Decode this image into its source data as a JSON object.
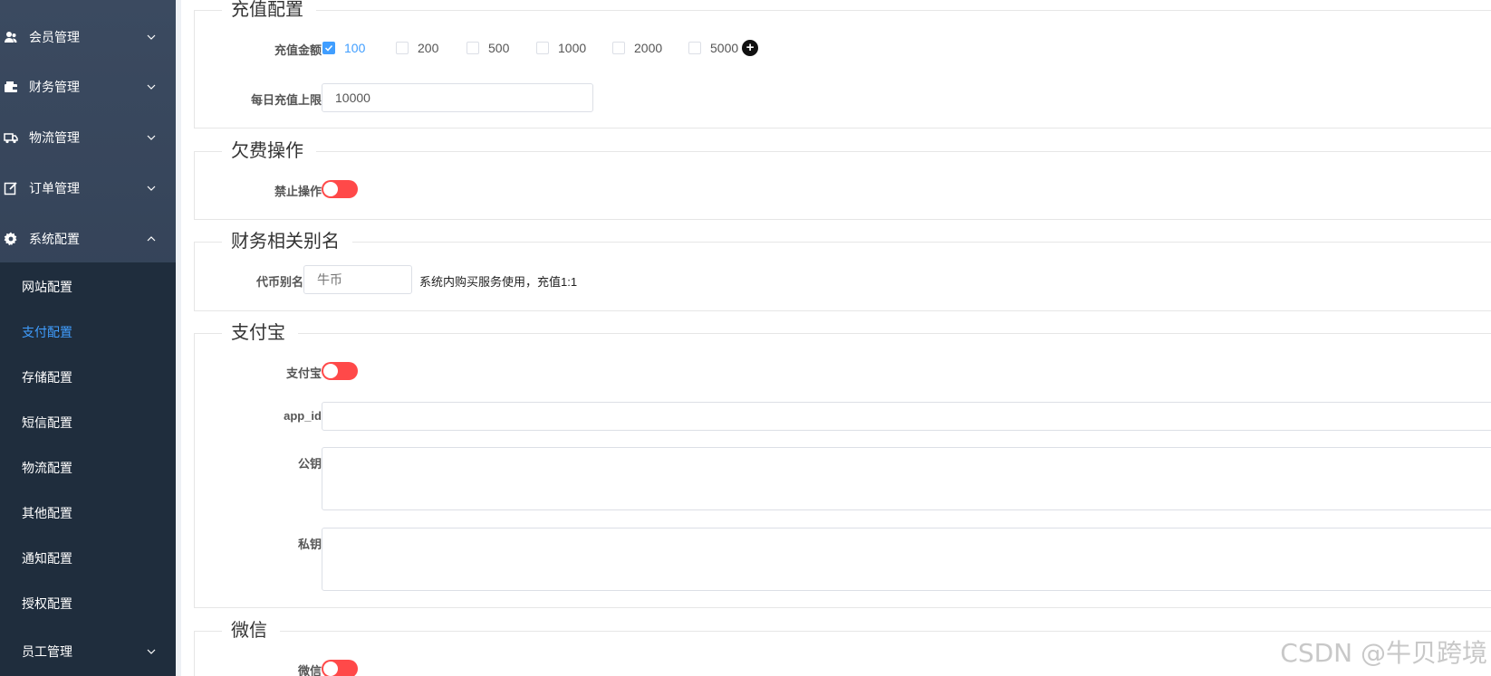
{
  "sidebar": {
    "items": [
      {
        "label": "会员管理",
        "icon": "users-icon",
        "expanded": false
      },
      {
        "label": "财务管理",
        "icon": "wallet-icon",
        "expanded": false
      },
      {
        "label": "物流管理",
        "icon": "truck-icon",
        "expanded": false
      },
      {
        "label": "订单管理",
        "icon": "edit-icon",
        "expanded": false
      },
      {
        "label": "系统配置",
        "icon": "gear-icon",
        "expanded": true
      }
    ],
    "submenu": [
      {
        "label": "网站配置",
        "active": false
      },
      {
        "label": "支付配置",
        "active": true
      },
      {
        "label": "存储配置",
        "active": false
      },
      {
        "label": "短信配置",
        "active": false
      },
      {
        "label": "物流配置",
        "active": false
      },
      {
        "label": "其他配置",
        "active": false
      },
      {
        "label": "通知配置",
        "active": false
      },
      {
        "label": "授权配置",
        "active": false
      }
    ],
    "staff": {
      "label": "员工管理",
      "icon": "chevron-down-icon"
    }
  },
  "recharge": {
    "legend": "充值配置",
    "amount_label": "充值金额",
    "amounts": [
      {
        "label": "100",
        "checked": true
      },
      {
        "label": "200",
        "checked": false
      },
      {
        "label": "500",
        "checked": false
      },
      {
        "label": "1000",
        "checked": false
      },
      {
        "label": "2000",
        "checked": false
      },
      {
        "label": "5000",
        "checked": false
      }
    ],
    "add_icon": "plus-circle-icon",
    "daily_label": "每日充值上限",
    "daily_value": "10000"
  },
  "arrears": {
    "legend": "欠费操作",
    "forbid_label": "禁止操作",
    "forbid_on": false
  },
  "alias": {
    "legend": "财务相关别名",
    "token_label": "代币别名",
    "token_placeholder": "牛币",
    "hint": "系统内购买服务使用，充值1:1"
  },
  "alipay": {
    "legend": "支付宝",
    "switch_label": "支付宝",
    "switch_on": false,
    "app_id_label": "app_id",
    "app_id_value": "",
    "public_key_label": "公钥",
    "private_key_label": "私钥"
  },
  "wechat": {
    "legend": "微信",
    "switch_label": "微信",
    "switch_on": false
  },
  "watermark": "CSDN @牛贝跨境",
  "colors": {
    "accent": "#409eff",
    "switch_off": "#ff4949",
    "sidebar": "#2c3a4f",
    "submenu": "#1f2d3d"
  }
}
